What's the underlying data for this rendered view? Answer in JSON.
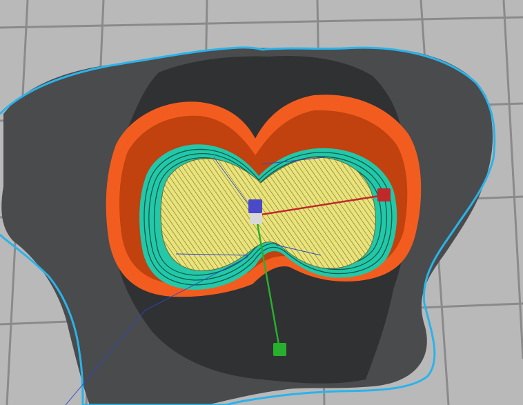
{
  "viewport": {
    "background_color": "#b9b9b9",
    "grid_color": "#8a8a8a"
  },
  "scene": {
    "colors": {
      "skirt_outline": "#2ab3ea",
      "shadow_shape": "#4a4b4c",
      "shadow_dark": "#2d2f31",
      "outer_wall": "#f25d1f",
      "outer_wall_dark": "#b83c0d",
      "inner_wall": "#22c8a8",
      "inner_wall_dark": "#0f5a4e",
      "infill": "#e9e37a",
      "infill_lines": "#6d6a30",
      "travel_lines": "#2c47c8"
    }
  },
  "gizmo": {
    "axis_x_color": "#c0282a",
    "axis_y_color": "#27b02d",
    "axis_z_color": "#4a4ac8",
    "center_color": "#d8d8d8"
  }
}
